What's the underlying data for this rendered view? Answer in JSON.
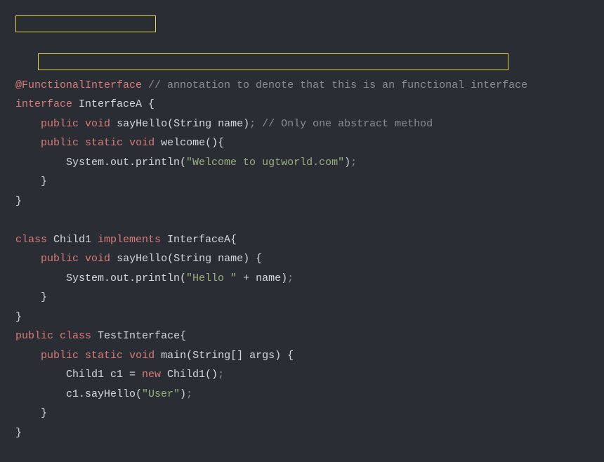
{
  "lines": {
    "l0_annotation": "@FunctionalInterface",
    "l0_comment": " // annotation to denote that this is an functional interface",
    "l1_keyword": "interface",
    "l1_name": " InterfaceA {",
    "l2_public": "public",
    "l2_void": "void",
    "l2_method": " sayHello(String name)",
    "l2_semi": ";",
    "l2_comment": " // Only one abstract method",
    "l3_public": "public",
    "l3_static": "static",
    "l3_void": "void",
    "l3_method": " welcome(){",
    "l4_call": "        System.out.println(",
    "l4_string": "\"Welcome to ugtworld.com\"",
    "l4_close": ")",
    "l4_semi": ";",
    "l5_brace": "    }",
    "l6_brace": "}",
    "l8_class": "class",
    "l8_name": " Child1 ",
    "l8_implements": "implements",
    "l8_iface": " InterfaceA{",
    "l9_public": "public",
    "l9_void": "void",
    "l9_method": " sayHello(String name) {",
    "l10_call": "        System.out.println(",
    "l10_string": "\"Hello \"",
    "l10_plus": " + name)",
    "l10_semi": ";",
    "l11_brace": "    }",
    "l12_brace": "}",
    "l13_public": "public",
    "l13_class": "class",
    "l13_name": " TestInterface{",
    "l14_public": "public",
    "l14_static": "static",
    "l14_void": "void",
    "l14_method": " main(String[] args) {",
    "l15_decl": "        Child1 c1 = ",
    "l15_new": "new",
    "l15_ctor": " Child1()",
    "l15_semi": ";",
    "l16_call": "        c1.sayHello(",
    "l16_string": "\"User\"",
    "l16_close": ")",
    "l16_semi": ";",
    "l17_brace": "    }",
    "l18_brace": "}"
  }
}
